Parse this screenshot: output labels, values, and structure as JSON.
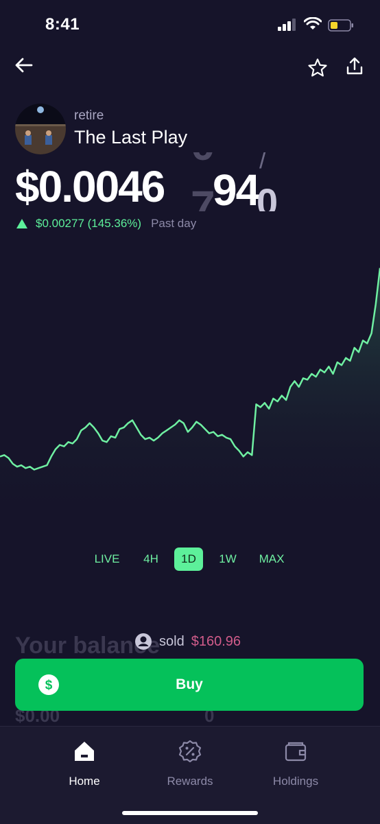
{
  "status_bar": {
    "time": "8:41"
  },
  "token": {
    "ticker": "retire",
    "name": "The Last Play",
    "price_main": "$0.0046",
    "price_rolling": {
      "current": "94",
      "ghost_above": "0",
      "ghost_below": "7",
      "ghost_small_above": "/",
      "ghost_small_below": "0"
    },
    "change_value": "$0.00277 (145.36%)",
    "change_period": "Past day"
  },
  "colors": {
    "accent": "#5df09a",
    "background": "#16142a",
    "buy_button": "#05c15a",
    "sold_amount": "#d25c8b"
  },
  "chart_data": {
    "type": "line",
    "title": "",
    "xlabel": "",
    "ylabel": "",
    "grid": false,
    "y": [
      0.4,
      0.41,
      0.39,
      0.35,
      0.33,
      0.34,
      0.32,
      0.33,
      0.31,
      0.32,
      0.33,
      0.34,
      0.4,
      0.45,
      0.48,
      0.47,
      0.5,
      0.49,
      0.52,
      0.58,
      0.6,
      0.63,
      0.6,
      0.56,
      0.51,
      0.5,
      0.54,
      0.53,
      0.59,
      0.6,
      0.63,
      0.65,
      0.6,
      0.55,
      0.52,
      0.53,
      0.51,
      0.53,
      0.56,
      0.58,
      0.6,
      0.62,
      0.65,
      0.63,
      0.57,
      0.6,
      0.64,
      0.62,
      0.59,
      0.56,
      0.57,
      0.54,
      0.55,
      0.53,
      0.52,
      0.47,
      0.44,
      0.4,
      0.43,
      0.41,
      0.76,
      0.74,
      0.77,
      0.73,
      0.8,
      0.78,
      0.82,
      0.79,
      0.88,
      0.92,
      0.88,
      0.94,
      0.93,
      0.97,
      0.95,
      1.0,
      0.98,
      1.02,
      0.97,
      1.05,
      1.03,
      1.08,
      1.06,
      1.15,
      1.12,
      1.2,
      1.18,
      1.25,
      1.45,
      1.7
    ],
    "ranges": [
      "LIVE",
      "4H",
      "1D",
      "1W",
      "MAX"
    ],
    "selected_range": "1D"
  },
  "balance": {
    "title": "Your balance",
    "sold_label": "sold",
    "sold_amount": "$160.96",
    "value_left": "$0.00",
    "value_right": "0"
  },
  "buy_button": {
    "label": "Buy",
    "icon": "dollar-coin-icon"
  },
  "nav": {
    "items": [
      {
        "label": "Home",
        "icon": "home-icon",
        "active": true
      },
      {
        "label": "Rewards",
        "icon": "rewards-badge-icon",
        "active": false
      },
      {
        "label": "Holdings",
        "icon": "wallet-icon",
        "active": false
      }
    ]
  }
}
